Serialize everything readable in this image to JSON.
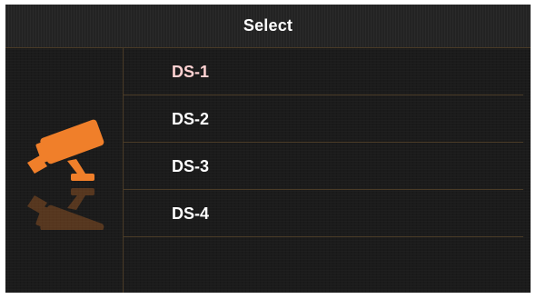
{
  "header": {
    "title": "Select"
  },
  "sidebar": {
    "icon": "security-camera-icon",
    "accent_color": "#f07f2a"
  },
  "list": {
    "items": [
      {
        "label": "DS-1",
        "selected": true
      },
      {
        "label": "DS-2",
        "selected": false
      },
      {
        "label": "DS-3",
        "selected": false
      },
      {
        "label": "DS-4",
        "selected": false
      }
    ],
    "selected_color": "#ffd2d2"
  }
}
